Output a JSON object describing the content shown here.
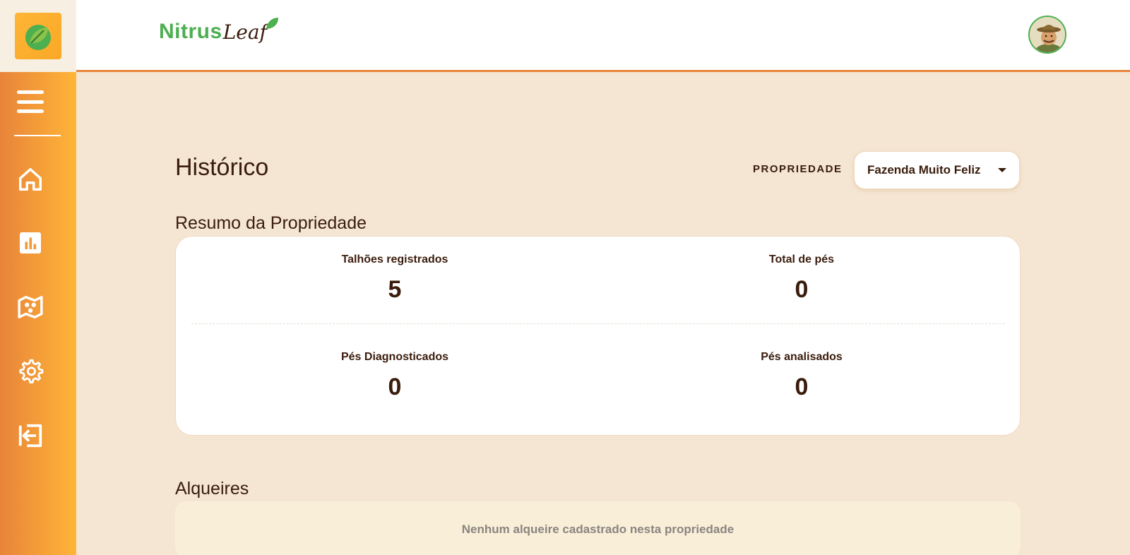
{
  "app": {
    "brand_part1": "Nitrus",
    "brand_part2": "Leaf",
    "accent": "#e8843a",
    "accent_light": "#ffb537",
    "brand_green": "#4caf50",
    "background": "#f5e6d3"
  },
  "sidebar": {
    "items": [
      {
        "name": "home",
        "icon": "home-icon"
      },
      {
        "name": "dashboard",
        "icon": "bar-chart-icon"
      },
      {
        "name": "map",
        "icon": "map-icon"
      },
      {
        "name": "settings",
        "icon": "gear-icon"
      },
      {
        "name": "logout",
        "icon": "logout-icon"
      }
    ]
  },
  "page": {
    "title": "Histórico",
    "property_label": "PROPRIEDADE",
    "property_selected": "Fazenda Muito Feliz"
  },
  "summary": {
    "title": "Resumo da Propriedade",
    "stats": [
      {
        "label": "Talhões registrados",
        "value": "5"
      },
      {
        "label": "Total de pés",
        "value": "0"
      },
      {
        "label": "Pés Diagnosticados",
        "value": "0"
      },
      {
        "label": "Pés analisados",
        "value": "0"
      }
    ]
  },
  "alqueires": {
    "title": "Alqueires",
    "empty_message": "Nenhum alqueire cadastrado nesta propriedade"
  }
}
